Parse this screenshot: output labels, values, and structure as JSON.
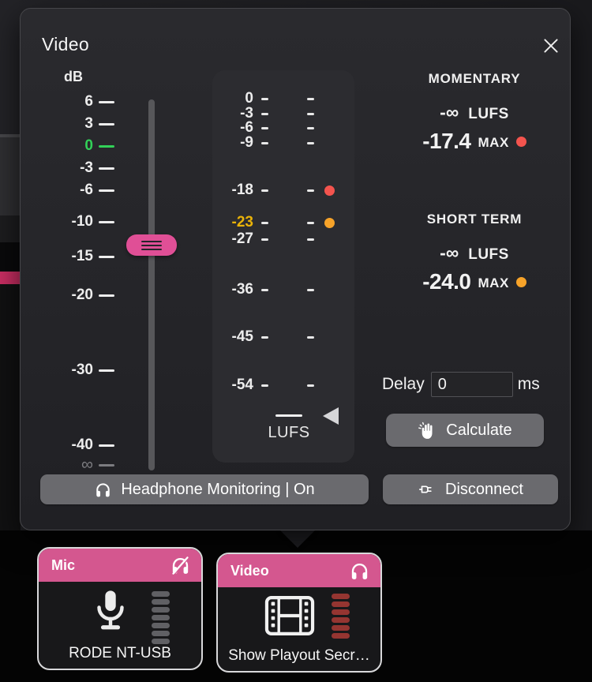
{
  "popup": {
    "title": "Video",
    "fader": {
      "unit": "dB",
      "ticks": [
        {
          "label": "6"
        },
        {
          "label": "3"
        },
        {
          "label": "0"
        },
        {
          "label": "-3"
        },
        {
          "label": "-6"
        },
        {
          "label": "-10"
        },
        {
          "label": "-15"
        },
        {
          "label": "-20"
        },
        {
          "label": "-30"
        },
        {
          "label": "-40"
        },
        {
          "label": "∞"
        }
      ],
      "zero_tick_color": "#32d158",
      "handle_color": "#e04f96"
    },
    "meter": {
      "ticks": [
        {
          "label": "0"
        },
        {
          "label": "-3"
        },
        {
          "label": "-6"
        },
        {
          "label": "-9"
        },
        {
          "label": "-18"
        },
        {
          "label": "-23"
        },
        {
          "label": "-27"
        },
        {
          "label": "-36"
        },
        {
          "label": "-45"
        },
        {
          "label": "-54"
        }
      ],
      "unit_label": "LUFS",
      "target_tick": "-23",
      "target_color": "#eab308",
      "peak_dot_tick": "-18",
      "peak_dot_color": "#f4544e",
      "avg_dot_tick": "-23",
      "avg_dot_color": "#f7a329"
    },
    "momentary": {
      "heading": "MOMENTARY",
      "value": "-∞",
      "unit": "LUFS",
      "max_value": "-17.4",
      "max_label": "MAX"
    },
    "short_term": {
      "heading": "SHORT TERM",
      "value": "-∞",
      "unit": "LUFS",
      "max_value": "-24.0",
      "max_label": "MAX"
    },
    "delay": {
      "label": "Delay",
      "value": "0",
      "unit": "ms"
    },
    "calculate_button": {
      "label": "Calculate",
      "icon": "clap-icon"
    },
    "headphone_button": {
      "label": "Headphone Monitoring | On",
      "icon": "headphones-icon"
    },
    "disconnect_button": {
      "label": "Disconnect",
      "icon": "plug-icon"
    }
  },
  "tiles": {
    "mic": {
      "header": "Mic",
      "header_icon": "headphones-muted-icon",
      "device_icon": "microphone-icon",
      "label": "RODE NT-USB",
      "meter_segments": 7
    },
    "video": {
      "header": "Video",
      "header_icon": "headphones-icon",
      "device_icon": "film-icon",
      "label": "Show Playout Secr…",
      "meter_segments": 6
    }
  },
  "colors": {
    "accent_pink": "#e04f96",
    "header_pink": "#d4578f",
    "left_bar_pink": "#cb2e63",
    "zero_db_green": "#32d158",
    "target_yellow": "#eab308",
    "peak_red": "#f4544e",
    "average_orange": "#f7a329",
    "button_gray": "#6a6a6e",
    "popup_bg": "#252529"
  }
}
